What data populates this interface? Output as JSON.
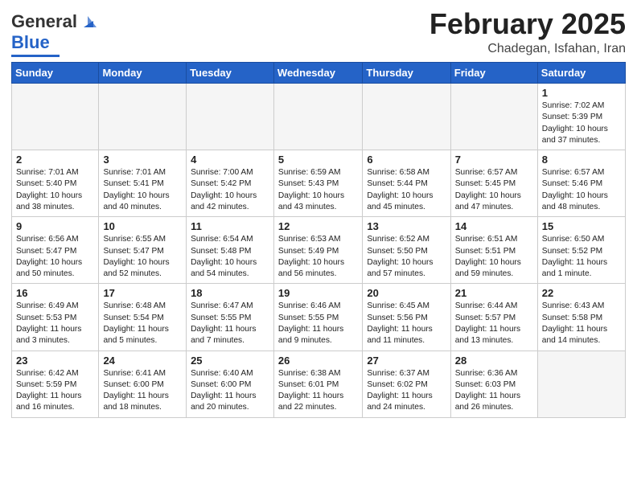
{
  "header": {
    "logo_general": "General",
    "logo_blue": "Blue",
    "month_year": "February 2025",
    "location": "Chadegan, Isfahan, Iran"
  },
  "weekdays": [
    "Sunday",
    "Monday",
    "Tuesday",
    "Wednesday",
    "Thursday",
    "Friday",
    "Saturday"
  ],
  "weeks": [
    [
      {
        "day": "",
        "info": ""
      },
      {
        "day": "",
        "info": ""
      },
      {
        "day": "",
        "info": ""
      },
      {
        "day": "",
        "info": ""
      },
      {
        "day": "",
        "info": ""
      },
      {
        "day": "",
        "info": ""
      },
      {
        "day": "1",
        "info": "Sunrise: 7:02 AM\nSunset: 5:39 PM\nDaylight: 10 hours\nand 37 minutes."
      }
    ],
    [
      {
        "day": "2",
        "info": "Sunrise: 7:01 AM\nSunset: 5:40 PM\nDaylight: 10 hours\nand 38 minutes."
      },
      {
        "day": "3",
        "info": "Sunrise: 7:01 AM\nSunset: 5:41 PM\nDaylight: 10 hours\nand 40 minutes."
      },
      {
        "day": "4",
        "info": "Sunrise: 7:00 AM\nSunset: 5:42 PM\nDaylight: 10 hours\nand 42 minutes."
      },
      {
        "day": "5",
        "info": "Sunrise: 6:59 AM\nSunset: 5:43 PM\nDaylight: 10 hours\nand 43 minutes."
      },
      {
        "day": "6",
        "info": "Sunrise: 6:58 AM\nSunset: 5:44 PM\nDaylight: 10 hours\nand 45 minutes."
      },
      {
        "day": "7",
        "info": "Sunrise: 6:57 AM\nSunset: 5:45 PM\nDaylight: 10 hours\nand 47 minutes."
      },
      {
        "day": "8",
        "info": "Sunrise: 6:57 AM\nSunset: 5:46 PM\nDaylight: 10 hours\nand 48 minutes."
      }
    ],
    [
      {
        "day": "9",
        "info": "Sunrise: 6:56 AM\nSunset: 5:47 PM\nDaylight: 10 hours\nand 50 minutes."
      },
      {
        "day": "10",
        "info": "Sunrise: 6:55 AM\nSunset: 5:47 PM\nDaylight: 10 hours\nand 52 minutes."
      },
      {
        "day": "11",
        "info": "Sunrise: 6:54 AM\nSunset: 5:48 PM\nDaylight: 10 hours\nand 54 minutes."
      },
      {
        "day": "12",
        "info": "Sunrise: 6:53 AM\nSunset: 5:49 PM\nDaylight: 10 hours\nand 56 minutes."
      },
      {
        "day": "13",
        "info": "Sunrise: 6:52 AM\nSunset: 5:50 PM\nDaylight: 10 hours\nand 57 minutes."
      },
      {
        "day": "14",
        "info": "Sunrise: 6:51 AM\nSunset: 5:51 PM\nDaylight: 10 hours\nand 59 minutes."
      },
      {
        "day": "15",
        "info": "Sunrise: 6:50 AM\nSunset: 5:52 PM\nDaylight: 11 hours\nand 1 minute."
      }
    ],
    [
      {
        "day": "16",
        "info": "Sunrise: 6:49 AM\nSunset: 5:53 PM\nDaylight: 11 hours\nand 3 minutes."
      },
      {
        "day": "17",
        "info": "Sunrise: 6:48 AM\nSunset: 5:54 PM\nDaylight: 11 hours\nand 5 minutes."
      },
      {
        "day": "18",
        "info": "Sunrise: 6:47 AM\nSunset: 5:55 PM\nDaylight: 11 hours\nand 7 minutes."
      },
      {
        "day": "19",
        "info": "Sunrise: 6:46 AM\nSunset: 5:55 PM\nDaylight: 11 hours\nand 9 minutes."
      },
      {
        "day": "20",
        "info": "Sunrise: 6:45 AM\nSunset: 5:56 PM\nDaylight: 11 hours\nand 11 minutes."
      },
      {
        "day": "21",
        "info": "Sunrise: 6:44 AM\nSunset: 5:57 PM\nDaylight: 11 hours\nand 13 minutes."
      },
      {
        "day": "22",
        "info": "Sunrise: 6:43 AM\nSunset: 5:58 PM\nDaylight: 11 hours\nand 14 minutes."
      }
    ],
    [
      {
        "day": "23",
        "info": "Sunrise: 6:42 AM\nSunset: 5:59 PM\nDaylight: 11 hours\nand 16 minutes."
      },
      {
        "day": "24",
        "info": "Sunrise: 6:41 AM\nSunset: 6:00 PM\nDaylight: 11 hours\nand 18 minutes."
      },
      {
        "day": "25",
        "info": "Sunrise: 6:40 AM\nSunset: 6:00 PM\nDaylight: 11 hours\nand 20 minutes."
      },
      {
        "day": "26",
        "info": "Sunrise: 6:38 AM\nSunset: 6:01 PM\nDaylight: 11 hours\nand 22 minutes."
      },
      {
        "day": "27",
        "info": "Sunrise: 6:37 AM\nSunset: 6:02 PM\nDaylight: 11 hours\nand 24 minutes."
      },
      {
        "day": "28",
        "info": "Sunrise: 6:36 AM\nSunset: 6:03 PM\nDaylight: 11 hours\nand 26 minutes."
      },
      {
        "day": "",
        "info": ""
      }
    ]
  ]
}
